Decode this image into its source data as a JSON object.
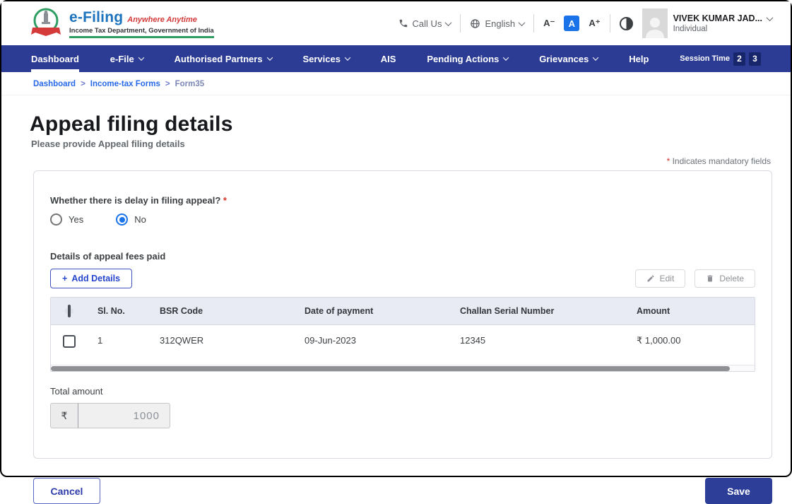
{
  "header": {
    "brand": {
      "name": "e-Filing",
      "tagline": "Anywhere Anytime",
      "subtitle": "Income Tax Department, Government of India"
    },
    "call_us_label": "Call Us",
    "language_label": "English",
    "font_controls": {
      "decrease": "A⁻",
      "normal": "A",
      "increase": "A⁺"
    },
    "user": {
      "name": "VIVEK KUMAR JAD...",
      "type": "Individual"
    }
  },
  "nav": {
    "items": [
      {
        "label": "Dashboard"
      },
      {
        "label": "e-File"
      },
      {
        "label": "Authorised Partners"
      },
      {
        "label": "Services"
      },
      {
        "label": "AIS"
      },
      {
        "label": "Pending Actions"
      },
      {
        "label": "Grievances"
      },
      {
        "label": "Help"
      }
    ],
    "session_label": "Session Time",
    "session_minutes": "2",
    "session_seconds": "3"
  },
  "breadcrumb": {
    "items": [
      "Dashboard",
      "Income-tax Forms",
      "Form35"
    ],
    "separator": ">"
  },
  "page": {
    "title": "Appeal filing details",
    "subtitle": "Please provide Appeal filing details",
    "mandatory_asterisk": "*",
    "mandatory_note": "Indicates mandatory fields"
  },
  "form": {
    "delay_question": "Whether there is delay in filing appeal?",
    "delay_required_mark": "*",
    "delay_options": [
      {
        "label": "Yes",
        "selected": false
      },
      {
        "label": "No",
        "selected": true
      }
    ],
    "fees_section_label": "Details of appeal fees paid",
    "add_details_plus": "+",
    "add_details_label": "Add Details",
    "edit_label": "Edit",
    "delete_label": "Delete",
    "table": {
      "headers": [
        "Sl. No.",
        "BSR Code",
        "Date of payment",
        "Challan Serial Number",
        "Amount"
      ],
      "rows": [
        {
          "sl_no": "1",
          "bsr_code": "312QWER",
          "date_of_payment": "09-Jun-2023",
          "challan_serial_number": "12345",
          "amount": "₹ 1,000.00"
        }
      ]
    },
    "total_amount_label": "Total amount",
    "currency_symbol": "₹",
    "total_amount_value": "1000"
  },
  "actions": {
    "cancel_label": "Cancel",
    "save_label": "Save"
  },
  "colors": {
    "navbar": "#2c3c94",
    "session_box": "#17266b",
    "accent_blue": "#1a73e8",
    "link_blue": "#2769e8",
    "brand_blue": "#1e73be",
    "brand_red": "#d43a3a",
    "brand_green": "#2f9e63",
    "save_navy": "#2d3e99",
    "mandatory_red": "#d93025",
    "table_header_bg": "#e9ebf4"
  }
}
